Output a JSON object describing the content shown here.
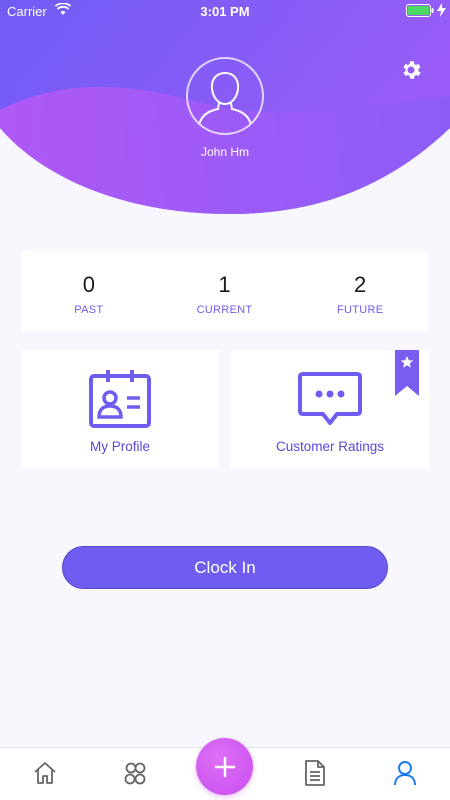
{
  "status_bar": {
    "carrier": "Carrier",
    "time": "3:01 PM"
  },
  "profile": {
    "name": "John Hm"
  },
  "stats": [
    {
      "value": "0",
      "label": "PAST"
    },
    {
      "value": "1",
      "label": "CURRENT"
    },
    {
      "value": "2",
      "label": "FUTURE"
    }
  ],
  "cards": {
    "profile_label": "My Profile",
    "ratings_label": "Customer Ratings"
  },
  "actions": {
    "clock_in_label": "Clock In"
  },
  "tab_bar": {
    "items": [
      "home-icon",
      "team-icon",
      "add-icon",
      "document-icon",
      "user-icon"
    ],
    "active": "user-icon"
  },
  "colors": {
    "accent": "#6f5cf0",
    "header_gradient_start": "#7a5cf5",
    "header_gradient_end": "#b15af6",
    "fab": "#d35ef2",
    "active_tab": "#1f7cf0",
    "bookmark": "#7a5cf0"
  }
}
